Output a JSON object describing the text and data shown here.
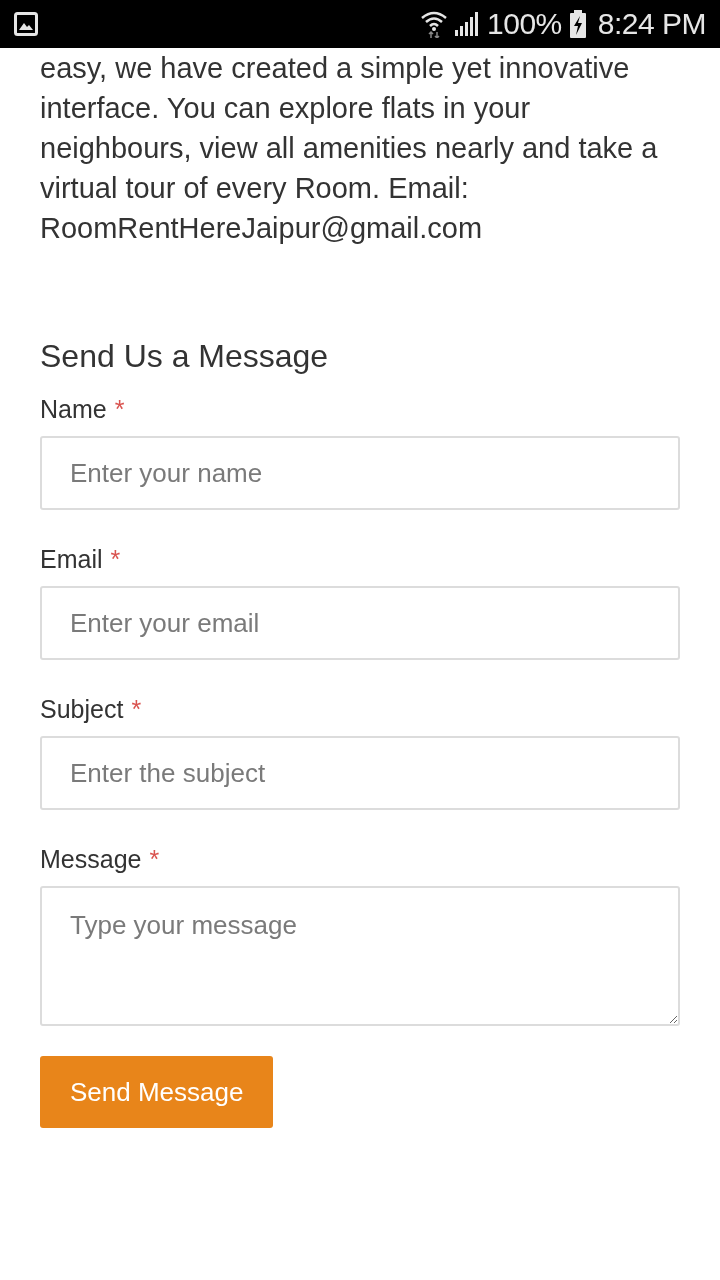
{
  "status_bar": {
    "battery": "100%",
    "time": "8:24 PM"
  },
  "intro": {
    "text": "easy, we have created a simple yet innovative interface. You can explore flats in your neighbours, view all amenities nearly and take a virtual tour of every Room. Email: RoomRentHereJaipur@gmail.com"
  },
  "contact_form": {
    "title": "Send Us a Message",
    "fields": [
      {
        "kind": "input",
        "label": "Name",
        "required_mark": "*",
        "placeholder": "Enter your name"
      },
      {
        "kind": "input",
        "label": "Email",
        "required_mark": "*",
        "placeholder": "Enter your email"
      },
      {
        "kind": "input",
        "label": "Subject",
        "required_mark": "*",
        "placeholder": "Enter the subject"
      },
      {
        "kind": "textarea",
        "label": "Message",
        "required_mark": "*",
        "placeholder": "Type your message"
      }
    ],
    "submit": {
      "label": "Send Message"
    }
  }
}
